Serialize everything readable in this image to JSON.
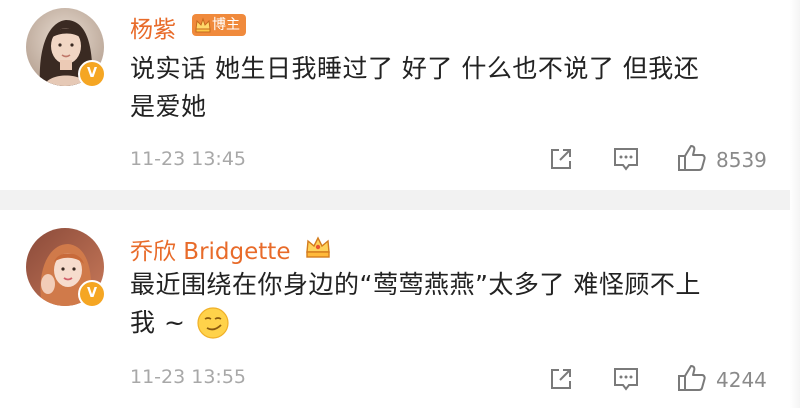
{
  "comments": [
    {
      "author": "杨紫",
      "badge_label": "博主",
      "verified_mark": "V",
      "text_line1": "说实话 她生日我睡过了 好了 什么也不说了 但我还",
      "text_line2": "是爱她",
      "timestamp": "11-23 13:45",
      "like_count": "8539"
    },
    {
      "author": "乔欣 Bridgette",
      "verified_mark": "V",
      "text_line1": "最近围绕在你身边的“莺莺燕燕”太多了 难怪顾不上",
      "text_line2": "我 ~",
      "emoji": "grinning-smirk-emoji",
      "timestamp": "11-23 13:55",
      "like_count": "4244"
    }
  ],
  "colors": {
    "author": "#e86b2a",
    "badge_bg": "#f08a3c",
    "verified": "#f5a623",
    "text": "#222222",
    "meta": "#a8a8a8",
    "separator": "#f2f2f2"
  },
  "icons": [
    "share-icon",
    "comment-icon",
    "like-icon",
    "crown-icon"
  ]
}
